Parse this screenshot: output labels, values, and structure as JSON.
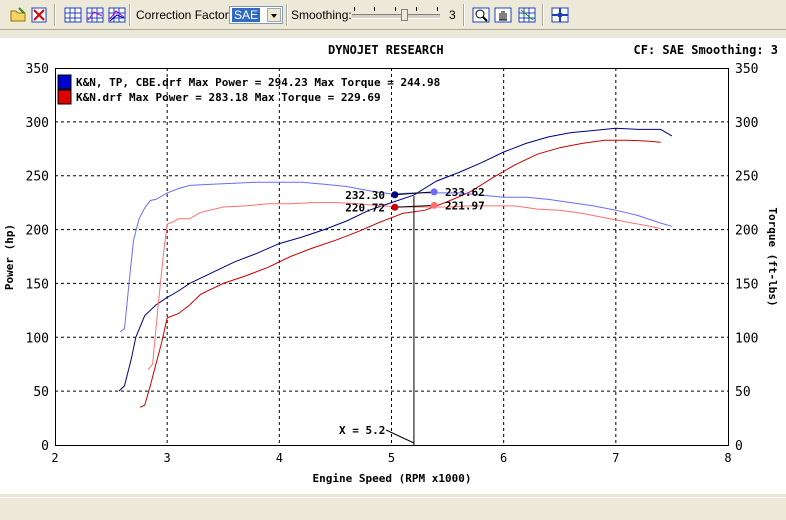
{
  "toolbar": {
    "correction_label": "Correction Factor:",
    "correction_value": "SAE",
    "smoothing_label": "Smoothing:",
    "smoothing_value": "3"
  },
  "header": {
    "title": "DYNOJET RESEARCH",
    "cf_text": "CF: SAE  Smoothing: 3"
  },
  "colors": {
    "blue_dark": "#000080",
    "blue_light": "#6b6bff",
    "red_dark": "#cc0000",
    "red_light": "#ff7070"
  },
  "chart_data": {
    "type": "line",
    "title": "DYNOJET RESEARCH",
    "xlabel": "Engine Speed (RPM x1000)",
    "ylabel": "Power (hp)",
    "y2label": "Torque (ft-lbs)",
    "xlim": [
      2,
      8
    ],
    "ylim": [
      0,
      350
    ],
    "y2lim": [
      0,
      350
    ],
    "x_ticks": [
      "2",
      "3",
      "4",
      "5",
      "6",
      "7",
      "8"
    ],
    "y_ticks": [
      "0",
      "50",
      "100",
      "150",
      "200",
      "250",
      "300",
      "350"
    ],
    "grid": true,
    "legend": [
      {
        "label": "K&N, TP, CBE.drf Max Power = 294.23 Max Torque = 244.98",
        "color": "#0000cc"
      },
      {
        "label": "K&N.drf Max Power = 283.18 Max Torque = 229.69",
        "color": "#dd0000"
      }
    ],
    "cursor": {
      "x": 5.2,
      "label": "X = 5.2"
    },
    "cursor_values": [
      {
        "text": "232.30",
        "color": "#000080"
      },
      {
        "text": "220.72",
        "color": "#cc0000"
      },
      {
        "text": "233.62",
        "color": "#6b6bff"
      },
      {
        "text": "221.97",
        "color": "#ff7070"
      }
    ],
    "series": [
      {
        "name": "K&N, TP, CBE.drf Power",
        "color": "#000080",
        "x": [
          2.57,
          2.62,
          2.68,
          2.72,
          2.8,
          2.9,
          3.0,
          3.1,
          3.2,
          3.4,
          3.6,
          3.8,
          4.0,
          4.2,
          4.4,
          4.6,
          4.8,
          5.0,
          5.2,
          5.4,
          5.6,
          5.8,
          6.0,
          6.2,
          6.4,
          6.6,
          6.8,
          7.0,
          7.2,
          7.4,
          7.5
        ],
        "y": [
          50,
          55,
          80,
          100,
          120,
          130,
          137,
          143,
          150,
          160,
          170,
          178,
          187,
          193,
          200,
          208,
          218,
          225,
          232,
          245,
          253,
          262,
          272,
          280,
          286,
          290,
          292,
          294,
          293,
          293,
          287
        ]
      },
      {
        "name": "K&N.drf Power",
        "color": "#cc0000",
        "x": [
          2.76,
          2.8,
          2.85,
          2.9,
          2.95,
          3.0,
          3.1,
          3.2,
          3.3,
          3.5,
          3.7,
          3.9,
          4.1,
          4.3,
          4.5,
          4.7,
          4.9,
          5.1,
          5.3,
          5.5,
          5.7,
          5.9,
          6.1,
          6.3,
          6.5,
          6.7,
          6.9,
          7.1,
          7.3,
          7.4
        ],
        "y": [
          35,
          37,
          55,
          75,
          95,
          118,
          122,
          130,
          140,
          150,
          157,
          165,
          175,
          183,
          190,
          198,
          207,
          215,
          218,
          226,
          235,
          248,
          260,
          270,
          276,
          280,
          283,
          283,
          282,
          281
        ]
      },
      {
        "name": "K&N, TP, CBE.drf Torque",
        "color": "#6b6bff",
        "x": [
          2.58,
          2.62,
          2.66,
          2.7,
          2.75,
          2.8,
          2.85,
          2.9,
          3.0,
          3.1,
          3.2,
          3.4,
          3.6,
          3.8,
          4.0,
          4.2,
          4.4,
          4.6,
          4.8,
          5.0,
          5.2,
          5.4,
          5.6,
          5.8,
          6.0,
          6.2,
          6.4,
          6.6,
          6.8,
          7.0,
          7.2,
          7.4,
          7.5
        ],
        "y": [
          105,
          108,
          150,
          190,
          210,
          220,
          227,
          228,
          234,
          238,
          241,
          242,
          243,
          244,
          244,
          244,
          242,
          240,
          236,
          233,
          234,
          234,
          234,
          232,
          230,
          230,
          228,
          225,
          222,
          218,
          213,
          206,
          203
        ]
      },
      {
        "name": "K&N.drf Torque",
        "color": "#ff7070",
        "x": [
          2.83,
          2.87,
          2.92,
          2.97,
          3.0,
          3.05,
          3.1,
          3.2,
          3.3,
          3.5,
          3.7,
          3.9,
          4.1,
          4.3,
          4.5,
          4.7,
          4.9,
          5.1,
          5.3,
          5.5,
          5.7,
          5.9,
          6.1,
          6.3,
          6.5,
          6.7,
          6.9,
          7.1,
          7.3,
          7.4
        ],
        "y": [
          70,
          75,
          130,
          180,
          205,
          207,
          210,
          210,
          216,
          221,
          222,
          224,
          224,
          225,
          225,
          224,
          222,
          221,
          221,
          221,
          222,
          222,
          222,
          219,
          218,
          215,
          211,
          207,
          203,
          201
        ]
      }
    ]
  }
}
